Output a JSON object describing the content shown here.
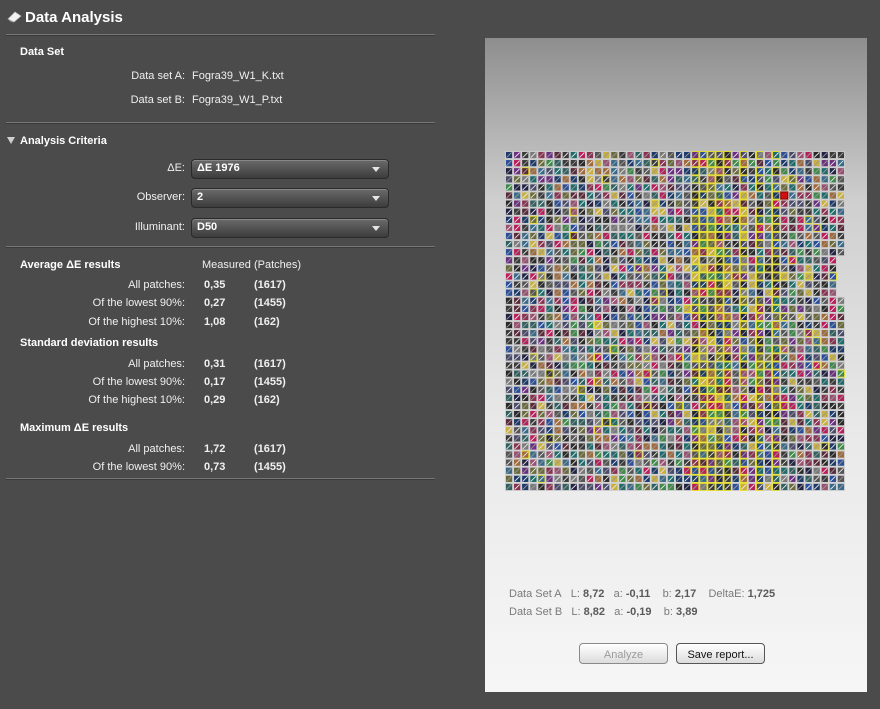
{
  "app": {
    "title": "Data Analysis"
  },
  "data_set": {
    "heading": "Data Set",
    "a_label": "Data set A:",
    "a_value": "Fogra39_W1_K.txt",
    "b_label": "Data set B:",
    "b_value": "Fogra39_W1_P.txt"
  },
  "criteria": {
    "heading": "Analysis Criteria",
    "de_label": "ΔE:",
    "de_value": "ΔE 1976",
    "observer_label": "Observer:",
    "observer_value": "2",
    "illuminant_label": "Illuminant:",
    "illuminant_value": "D50"
  },
  "results": {
    "average": {
      "heading": "Average ΔE results",
      "header": "Measured (Patches)",
      "rows": [
        {
          "label": "All patches:",
          "value": "0,35",
          "patches": "(1617)"
        },
        {
          "label": "Of the lowest 90%:",
          "value": "0,27",
          "patches": "(1455)"
        },
        {
          "label": "Of the highest 10%:",
          "value": "1,08",
          "patches": "(162)"
        }
      ]
    },
    "stddev": {
      "heading": "Standard deviation results",
      "rows": [
        {
          "label": "All patches:",
          "value": "0,31",
          "patches": "(1617)"
        },
        {
          "label": "Of the lowest 90%:",
          "value": "0,17",
          "patches": "(1455)"
        },
        {
          "label": "Of the highest 10%:",
          "value": "0,29",
          "patches": "(162)"
        }
      ]
    },
    "maximum": {
      "heading": "Maximum ΔE results",
      "rows": [
        {
          "label": "All patches:",
          "value": "1,72",
          "patches": "(1617)"
        },
        {
          "label": "Of the lowest 90%:",
          "value": "0,73",
          "patches": "(1455)"
        }
      ]
    }
  },
  "patch_readout": {
    "a": {
      "label": "Data Set A",
      "L_label": "L:",
      "L": "8,72",
      "a_label": "a:",
      "a": "-0,11",
      "b_label": "b:",
      "b": "2,17",
      "de_label": "DeltaE:",
      "de": "1,725"
    },
    "b": {
      "label": "Data Set B",
      "L_label": "L:",
      "L": "8,82",
      "a_label": "a:",
      "a": "-0,19",
      "b_label": "b:",
      "b": "3,89"
    }
  },
  "buttons": {
    "analyze": "Analyze",
    "save_report": "Save report..."
  },
  "colors": {
    "background": "#4b4b4b",
    "highlight_yellow": "#e8e030",
    "selected_red": "#d01010"
  }
}
